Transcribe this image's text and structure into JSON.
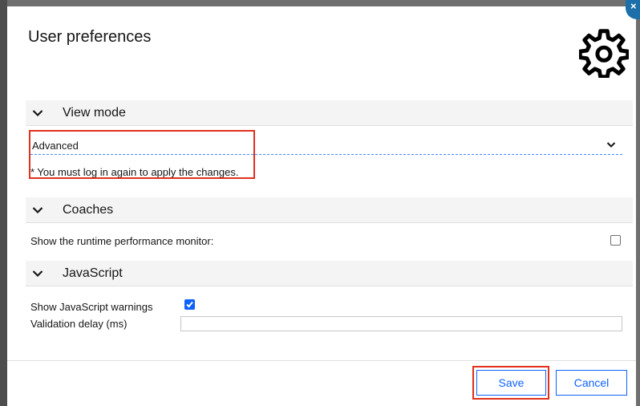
{
  "dialog": {
    "title": "User preferences",
    "close_label": "×"
  },
  "view_mode": {
    "header": "View mode",
    "selected": "Advanced",
    "note": "* You must log in again to apply the changes."
  },
  "coaches": {
    "header": "Coaches",
    "monitor_label": "Show the runtime performance monitor:",
    "monitor_checked": false
  },
  "javascript": {
    "header": "JavaScript",
    "warnings_label": "Show JavaScript warnings",
    "warnings_checked": true,
    "delay_label": "Validation delay (ms)",
    "delay_value": ""
  },
  "footer": {
    "save_label": "Save",
    "cancel_label": "Cancel"
  },
  "colors": {
    "accent": "#0f62fe",
    "highlight": "#e0301e"
  },
  "icons": {
    "settings": "gear-icon",
    "collapse": "chevron-down-icon",
    "close": "close-icon"
  }
}
